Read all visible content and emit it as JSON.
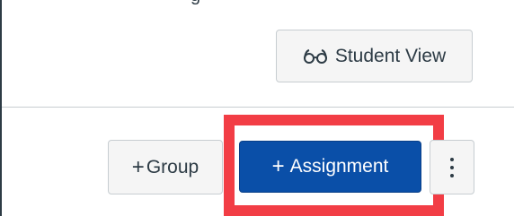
{
  "header": {
    "partial_title": "g"
  },
  "toolbar": {
    "student_view_label": "Student View",
    "group_label": "Group",
    "assignment_label": "Assignment"
  },
  "colors": {
    "primary_button": "#0a4fa8",
    "highlight": "#f23d45",
    "text": "#2d3b45"
  },
  "icons": {
    "student_view": "glasses-icon",
    "group": "plus-icon",
    "assignment": "plus-icon",
    "more": "more-vertical-icon"
  }
}
